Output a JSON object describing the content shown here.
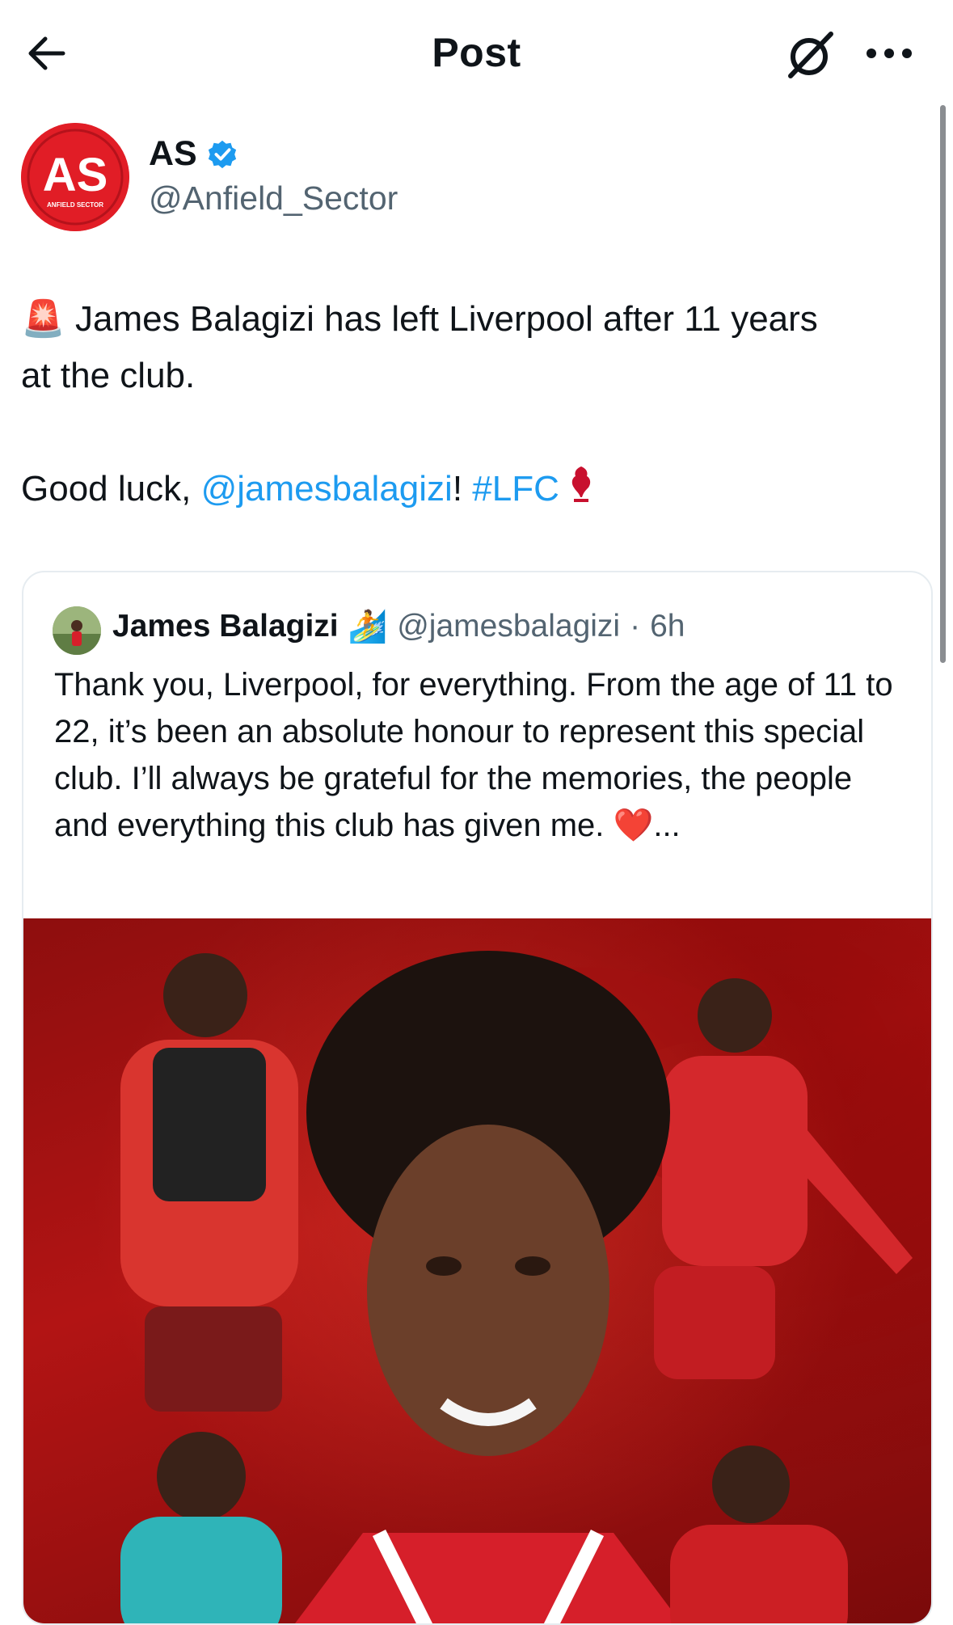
{
  "header": {
    "title": "Post",
    "back_icon": "arrow-left-icon",
    "grok_icon": "grok-icon",
    "more_icon": "more-horizontal-icon"
  },
  "author": {
    "name": "AS",
    "handle": "@Anfield_Sector",
    "verified": true,
    "avatar_text": "AS",
    "avatar_subtext": "ANFIELD SECTOR",
    "brand_color": "#e11d26"
  },
  "tweet": {
    "emoji_siren": "🚨",
    "line1": "James Balagizi has left Liverpool after 11 years",
    "line2": "at the club.",
    "goodluck_prefix": "Good luck, ",
    "mention": "@jamesbalagizi",
    "exclaim": "!",
    "hashtag": "#LFC"
  },
  "quote": {
    "name": "James Balagizi",
    "emoji": "🏄",
    "handle": "@jamesbalagizi",
    "separator": "·",
    "time": "6h",
    "text": "Thank you, Liverpool, for everything. From the age of 11 to 22, it’s been an absolute honour to represent this special club. I’ll always be grateful for the memories, the people and everything this club has given me.",
    "heart": "❤️",
    "ellipsis": "..."
  },
  "colors": {
    "link": "#1d9bf0",
    "secondary_text": "#536471",
    "verified_badge": "#1d9bf0"
  }
}
